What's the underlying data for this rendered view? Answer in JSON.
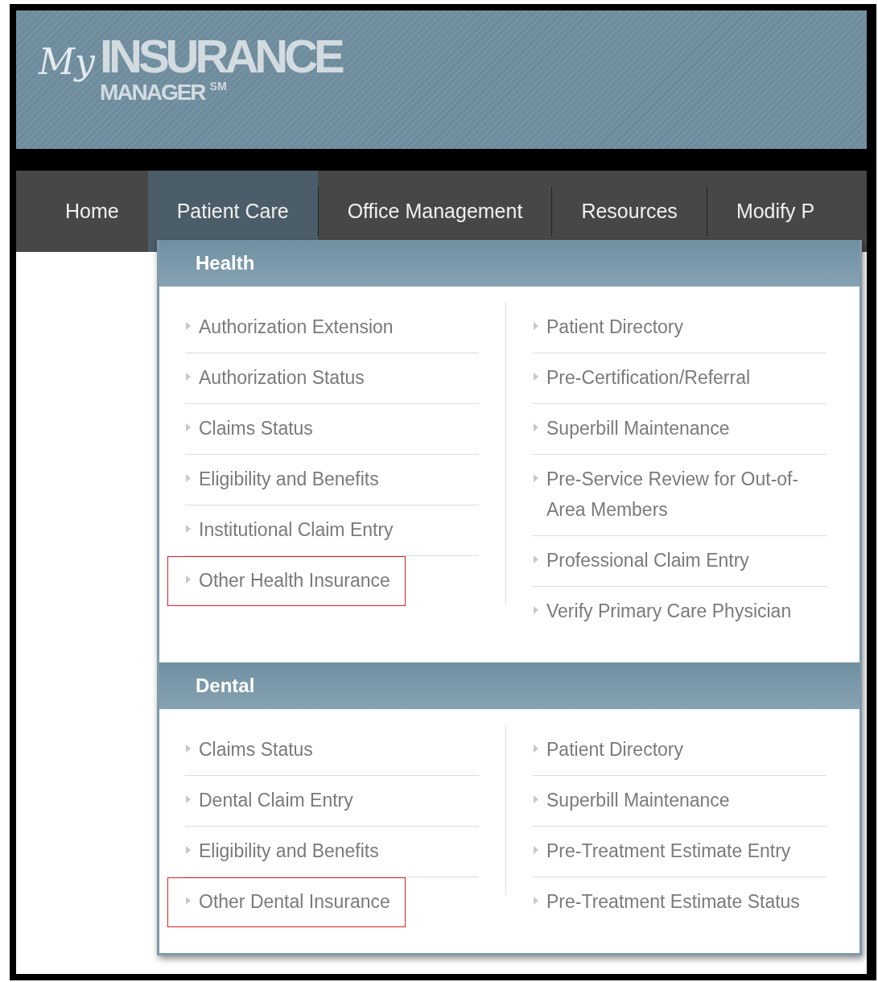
{
  "logo": {
    "script": "My",
    "title": "INSURANCE",
    "subtitle": "MANAGER",
    "mark": "SM"
  },
  "nav": [
    {
      "label": "Home",
      "selected": false
    },
    {
      "label": "Patient Care",
      "selected": true
    },
    {
      "label": "Office Management",
      "selected": false
    },
    {
      "label": "Resources",
      "selected": false
    },
    {
      "label": "Modify P",
      "selected": false
    }
  ],
  "menu": {
    "sections": [
      {
        "title": "Health",
        "columns": [
          [
            {
              "label": "Authorization Extension",
              "highlighted": false
            },
            {
              "label": "Authorization Status",
              "highlighted": false
            },
            {
              "label": "Claims Status",
              "highlighted": false
            },
            {
              "label": "Eligibility and Benefits",
              "highlighted": false
            },
            {
              "label": "Institutional Claim Entry",
              "highlighted": false
            },
            {
              "label": "Other Health Insurance",
              "highlighted": true
            }
          ],
          [
            {
              "label": "Patient Directory",
              "highlighted": false
            },
            {
              "label": "Pre-Certification/Referral",
              "highlighted": false
            },
            {
              "label": "Superbill Maintenance",
              "highlighted": false
            },
            {
              "label": "Pre-Service Review for Out-of-Area Members",
              "highlighted": false
            },
            {
              "label": "Professional Claim Entry",
              "highlighted": false
            },
            {
              "label": "Verify Primary Care Physician",
              "highlighted": false
            }
          ]
        ]
      },
      {
        "title": "Dental",
        "columns": [
          [
            {
              "label": "Claims Status",
              "highlighted": false
            },
            {
              "label": "Dental Claim Entry",
              "highlighted": false
            },
            {
              "label": "Eligibility and Benefits",
              "highlighted": false
            },
            {
              "label": "Other Dental Insurance",
              "highlighted": true
            }
          ],
          [
            {
              "label": "Patient Directory",
              "highlighted": false
            },
            {
              "label": "Superbill Maintenance",
              "highlighted": false
            },
            {
              "label": "Pre-Treatment Estimate Entry",
              "highlighted": false
            },
            {
              "label": "Pre-Treatment Estimate Status",
              "highlighted": false
            }
          ]
        ]
      }
    ]
  }
}
